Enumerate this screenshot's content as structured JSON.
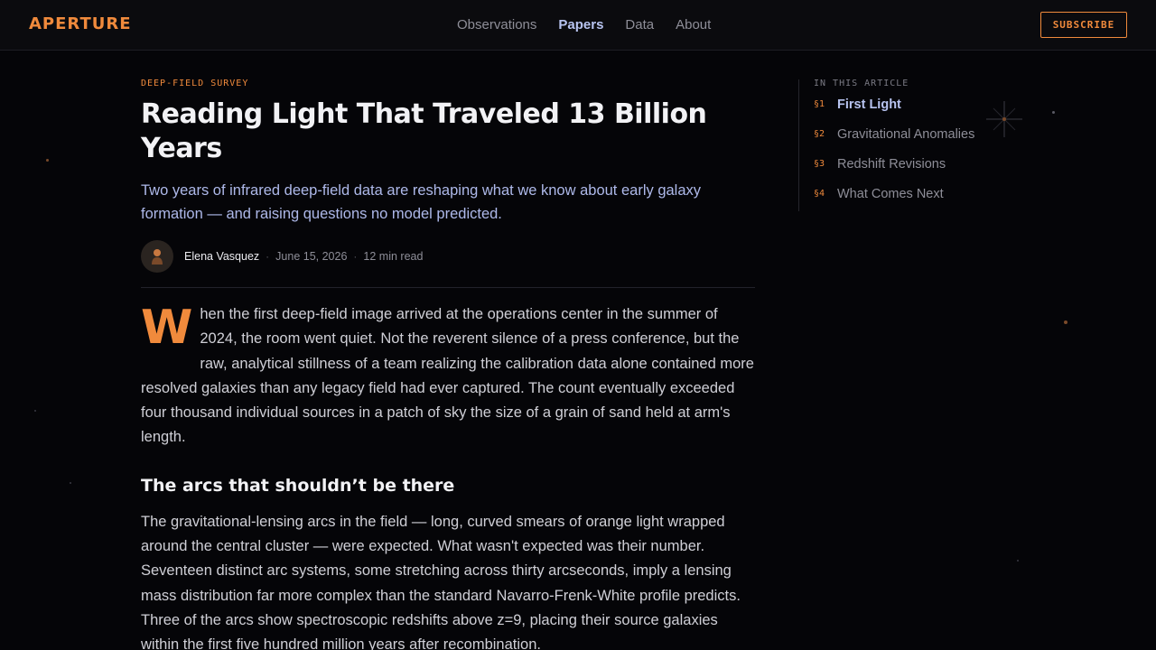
{
  "header": {
    "logo": "APERTURE",
    "nav": [
      {
        "label": "Observations"
      },
      {
        "label": "Papers"
      },
      {
        "label": "Data"
      },
      {
        "label": "About"
      }
    ],
    "active_nav": "Papers",
    "subscribe_label": "SUBSCRIBE"
  },
  "article": {
    "kicker": "DEEP-FIELD SURVEY",
    "title": "Reading Light That Traveled 13 Billion Years",
    "dek": "Two years of infrared deep-field data are reshaping what we know about early galaxy formation — and raising questions no model predicted.",
    "author": "Elena Vasquez",
    "date": "June 15, 2026",
    "read_time": "12 min read",
    "dropcap": "W",
    "p1": "hen the first deep-field image arrived at the operations center in the summer of 2024, the room went quiet. Not the reverent silence of a press conference, but the raw, analytical stillness of a team realizing the calibration data alone contained more resolved galaxies than any legacy field had ever captured. The count eventually exceeded four thousand individual sources in a patch of sky the size of a grain of sand held at arm's length.",
    "h2": "The arcs that shouldn’t be there",
    "p2": "The gravitational-lensing arcs in the field — long, curved smears of orange light wrapped around the central cluster — were expected. What wasn't expected was their number. Seventeen distinct arc systems, some stretching across thirty arcseconds, imply a lensing mass distribution far more complex than the standard Navarro-Frenk-White profile predicts. Three of the arcs show spectroscopic redshifts above z=9, placing their source galaxies within the first five hundred million years after recombination."
  },
  "toc": {
    "label": "IN THIS ARTICLE",
    "items": [
      {
        "num": "§1",
        "label": "First Light"
      },
      {
        "num": "§2",
        "label": "Gravitational Anomalies"
      },
      {
        "num": "§3",
        "label": "Redshift Revisions"
      },
      {
        "num": "§4",
        "label": "What Comes Next"
      }
    ],
    "active": "First Light"
  },
  "colors": {
    "accent": "#f08a3c",
    "link_active": "#b8c4f0",
    "background": "#050508"
  },
  "icons": {
    "avatar": "person-icon",
    "sparkle": "star-sparkle-icon"
  }
}
